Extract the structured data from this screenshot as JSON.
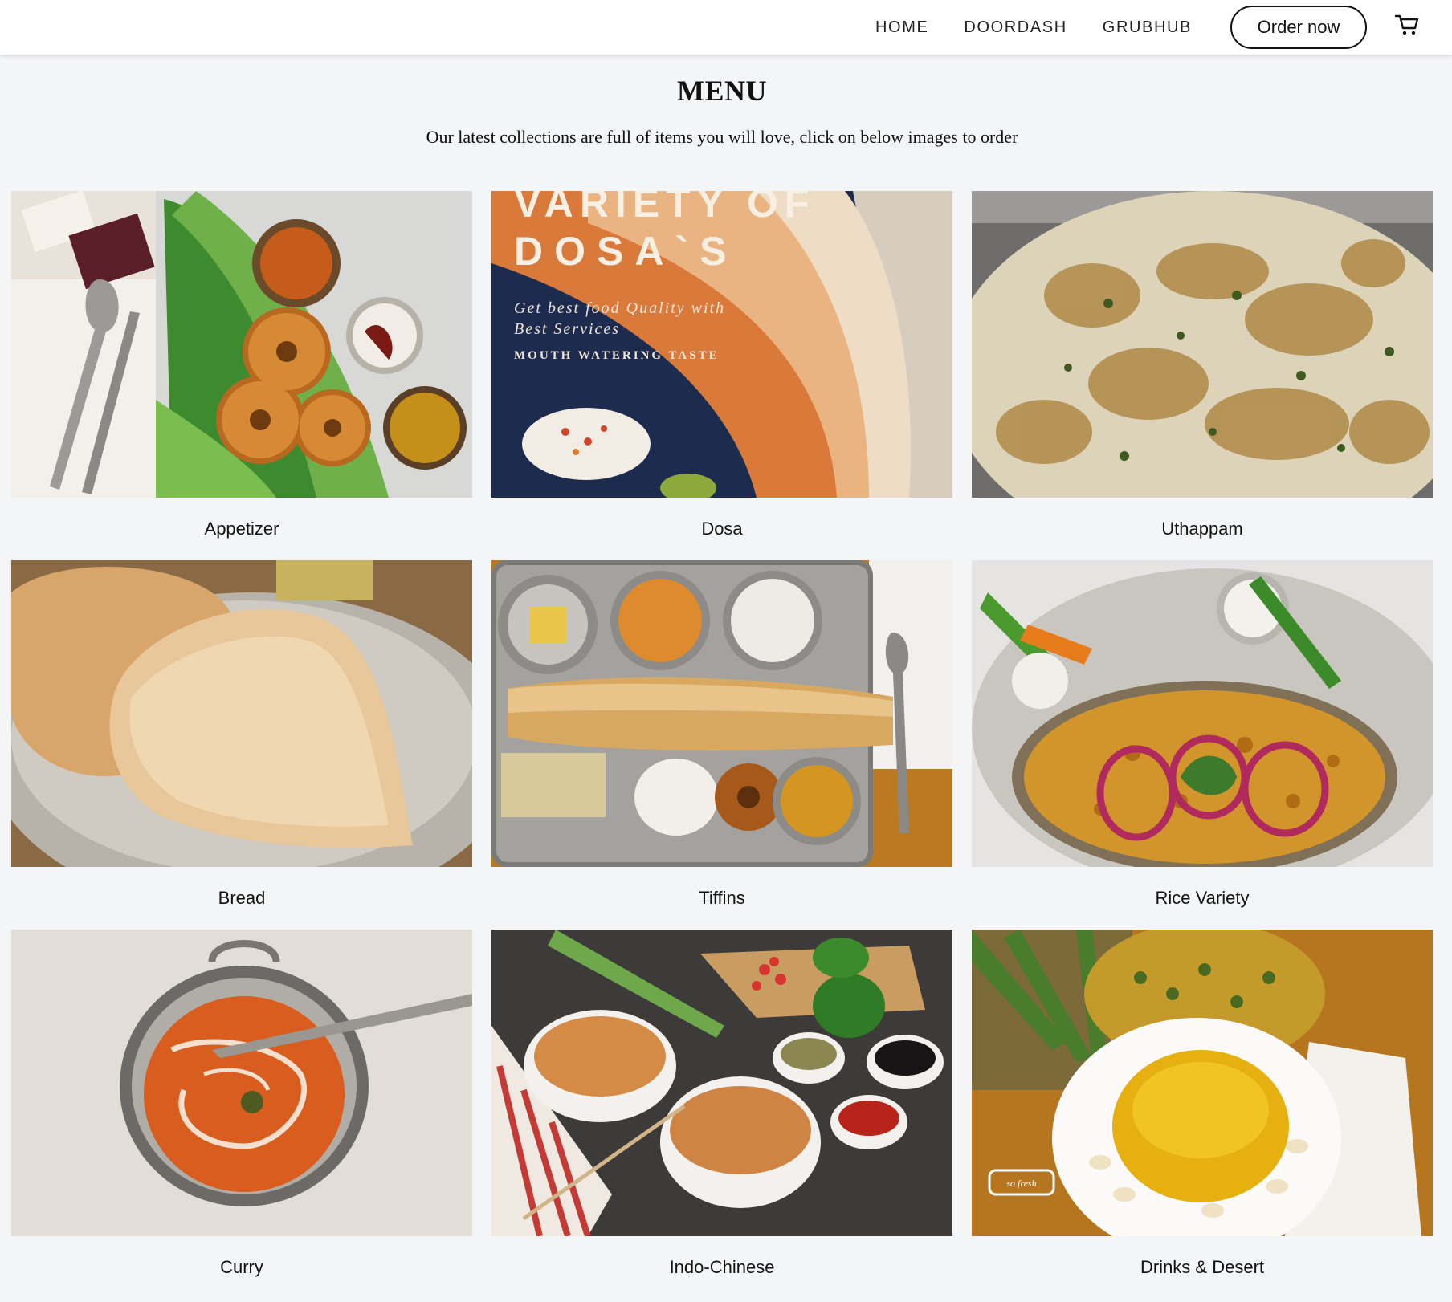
{
  "header": {
    "nav": [
      {
        "label": "HOME"
      },
      {
        "label": "DOORDASH"
      },
      {
        "label": "GRUBHUB"
      }
    ],
    "order_button": "Order now",
    "cart_icon": "cart-icon"
  },
  "page": {
    "title": "MENU",
    "subtitle": "Our latest collections are full of items you will love, click on below images to order"
  },
  "categories": [
    {
      "label": "Appetizer"
    },
    {
      "label": "Dosa",
      "overlay": {
        "line1": "VARIETY OF",
        "line2": "DOSA`S",
        "tag1": "Get best food Quality with",
        "tag2": "Best Services",
        "tag3": "MOUTH WATERING TASTE"
      }
    },
    {
      "label": "Uthappam"
    },
    {
      "label": "Bread"
    },
    {
      "label": "Tiffins"
    },
    {
      "label": "Rice Variety"
    },
    {
      "label": "Curry"
    },
    {
      "label": "Indo-Chinese"
    },
    {
      "label": "Drinks & Desert",
      "badge": "so fresh"
    }
  ],
  "colors": {
    "background": "#f4f5f7",
    "header": "#ffffff",
    "text": "#111111"
  }
}
